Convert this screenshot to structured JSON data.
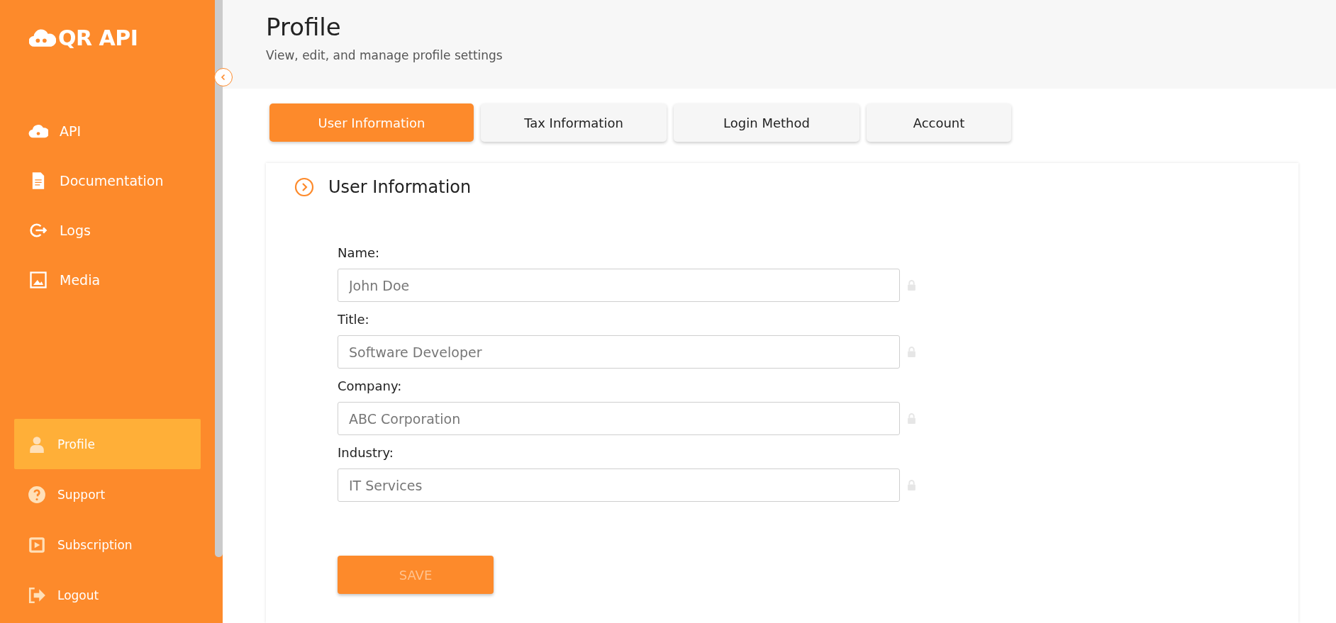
{
  "sidebar": {
    "logo": "QR API",
    "top_items": [
      {
        "label": "API",
        "selected": false
      },
      {
        "label": "Documentation",
        "selected": false
      },
      {
        "label": "Logs",
        "selected": false
      },
      {
        "label": "Media",
        "selected": false
      }
    ],
    "bottom_items": [
      {
        "label": "Profile",
        "selected": true
      },
      {
        "label": "Support",
        "selected": false
      },
      {
        "label": "Subscription",
        "selected": false
      },
      {
        "label": "Logout",
        "selected": false
      }
    ]
  },
  "header": {
    "title": "Profile",
    "subtitle": "View, edit, and manage profile settings"
  },
  "tabs": [
    {
      "label": "User Information",
      "selected": true
    },
    {
      "label": "Tax Information",
      "selected": false
    },
    {
      "label": "Login Method",
      "selected": false
    },
    {
      "label": "Account",
      "selected": false
    }
  ],
  "section": {
    "title": "User Information",
    "fields": [
      {
        "label": "Name:",
        "value": "John Doe",
        "disabled": true
      },
      {
        "label": "Title:",
        "value": "Software Developer",
        "disabled": true
      },
      {
        "label": "Company:",
        "value": "ABC Corporation",
        "disabled": true
      },
      {
        "label": "Industry:",
        "value": "IT Services",
        "disabled": true
      }
    ],
    "save_button": {
      "label": "SAVE",
      "disabled": true
    }
  }
}
